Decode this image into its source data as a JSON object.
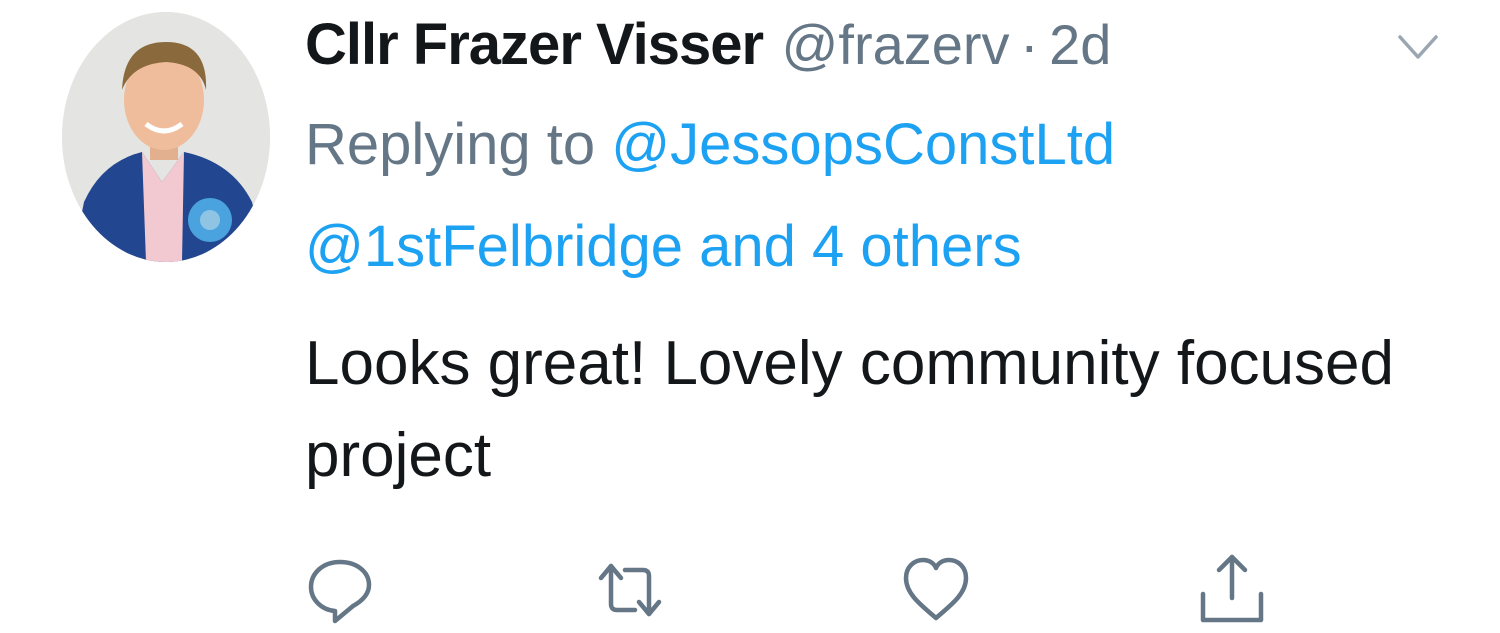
{
  "tweet": {
    "author_name": "Cllr Frazer Visser",
    "handle": "@frazerv",
    "separator": "·",
    "time": "2d",
    "replying_label": "Replying to",
    "mention_1": "@JessopsConstLtd",
    "mention_2": "@1stFelbridge and 4 others",
    "text": "Looks great! Lovely community focused project"
  },
  "icons": {
    "menu": "chevron-down-icon",
    "reply": "reply-icon",
    "retweet": "retweet-icon",
    "like": "heart-icon",
    "share": "share-icon"
  },
  "colors": {
    "text": "#14171a",
    "muted": "#657786",
    "link": "#1da1f2"
  }
}
